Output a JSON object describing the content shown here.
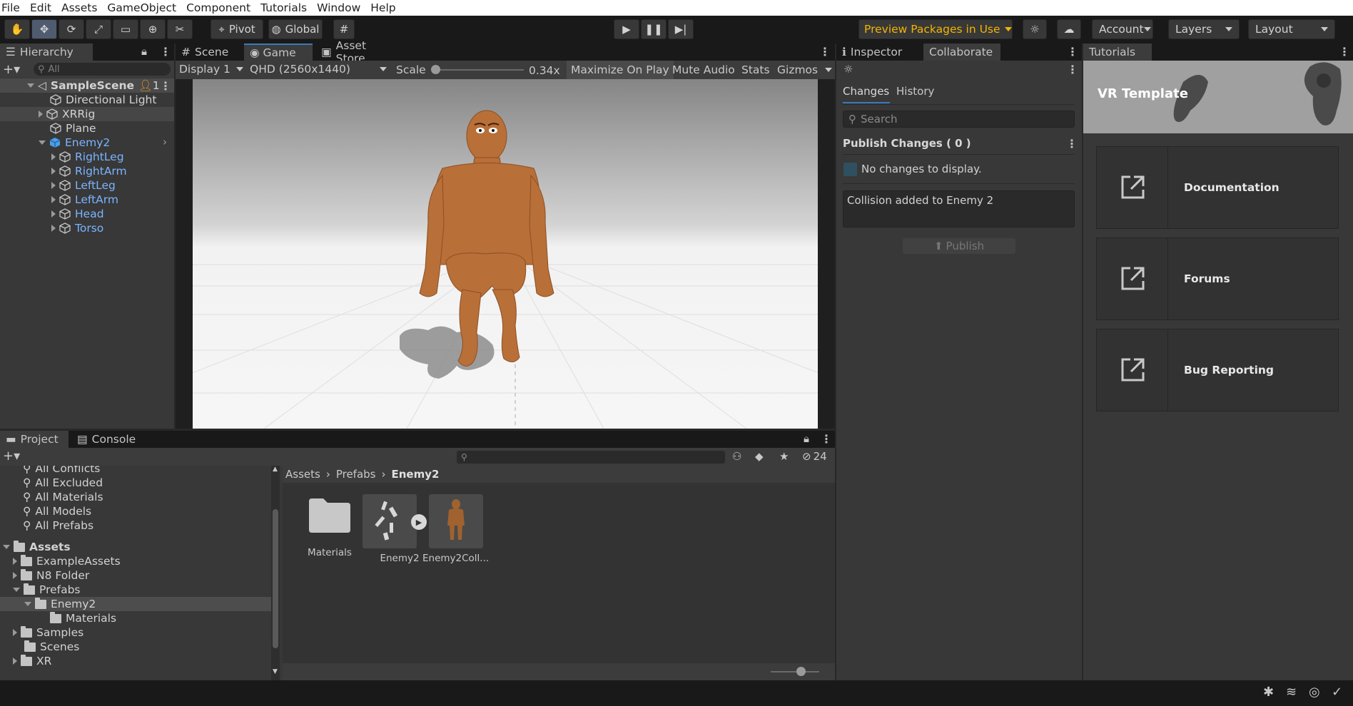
{
  "menu": [
    "File",
    "Edit",
    "Assets",
    "GameObject",
    "Component",
    "Tutorials",
    "Window",
    "Help"
  ],
  "toolbar": {
    "pivot": "Pivot",
    "global": "Global",
    "preview_packages": "Preview Packages in Use",
    "account": "Account",
    "layers": "Layers",
    "layout": "Layout"
  },
  "hierarchy": {
    "title": "Hierarchy",
    "search_placeholder": "All",
    "scene": "SampleScene",
    "scene_badge": "1",
    "items": [
      "Directional Light",
      "XRRig",
      "Plane",
      "Enemy2",
      "RightLeg",
      "RightArm",
      "LeftLeg",
      "LeftArm",
      "Head",
      "Torso"
    ]
  },
  "tabs": {
    "scene": "Scene",
    "game": "Game",
    "asset_store": "Asset Store"
  },
  "game_bar": {
    "display": "Display 1",
    "resolution": "QHD (2560x1440)",
    "scale_label": "Scale",
    "scale_value": "0.34x",
    "scale_fraction": 0.0,
    "maximize": "Maximize On Play",
    "mute": "Mute Audio",
    "stats": "Stats",
    "gizmos": "Gizmos"
  },
  "inspector": {
    "tab_inspector": "Inspector",
    "tab_collaborate": "Collaborate",
    "tab_changes": "Changes",
    "tab_history": "History",
    "search_placeholder": "Search",
    "publish_changes": "Publish Changes ( 0 )",
    "no_changes": "No changes to display.",
    "message": "Collision added to Enemy 2",
    "publish_button": "Publish"
  },
  "tutorials": {
    "title": "Tutorials",
    "banner": "VR Template",
    "cards": [
      "Documentation",
      "Forums",
      "Bug Reporting"
    ]
  },
  "project": {
    "tab_project": "Project",
    "tab_console": "Console",
    "hidden_count": "24",
    "favorites": [
      "All Conflicts",
      "All Excluded",
      "All Materials",
      "All Models",
      "All Prefabs"
    ],
    "tree_root": "Assets",
    "tree": [
      "ExampleAssets",
      "N8 Folder",
      "Prefabs",
      "Enemy2",
      "Materials",
      "Samples",
      "Scenes",
      "XR"
    ],
    "breadcrumb": [
      "Assets",
      "Prefabs",
      "Enemy2"
    ],
    "assets": [
      "Materials",
      "Enemy2",
      "Enemy2Coll..."
    ]
  },
  "colors": {
    "accent": "#3a79bb",
    "preview_text": "#f4b400",
    "blue_text": "#7ab4ff",
    "character": "#b96f38"
  }
}
